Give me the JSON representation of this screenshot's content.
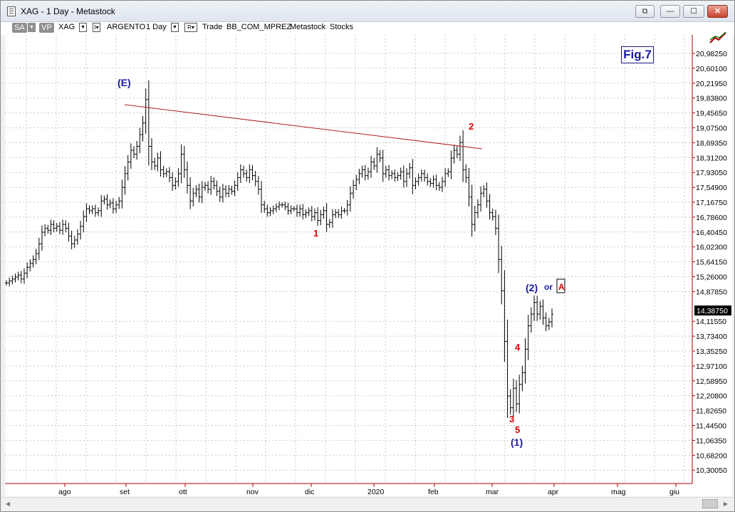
{
  "window": {
    "title": "XAG - 1 Day - Metastock",
    "buttons": {
      "restore2": "⧉",
      "minimize": "—",
      "maximize": "☐",
      "close": "✕"
    }
  },
  "toolbar": {
    "sa_label": "SA",
    "vp_label": "VP",
    "symbol": "XAG",
    "security_name": "ARGENTO",
    "periodicity": "1 Day",
    "mode": "Trade",
    "template": "BB_COM_MPREZ",
    "source": "Metastock",
    "category": "Stocks",
    "i_button": "I▾",
    "r_button": "R▾"
  },
  "figure_label": "Fig.7",
  "icons": {
    "toolbox": "chart-tool-icon",
    "app": "chart-window-icon"
  },
  "colors": {
    "bars": "#000000",
    "grid": "#c8c8c8",
    "axis": "#b00000",
    "trendline": "#b41e1e",
    "wave_red": "#e00000",
    "wave_blue": "#1a1aa0",
    "last_price_bg": "#000000"
  },
  "chart_data": {
    "type": "ohlc",
    "y_ticks": [
      "20,98250",
      "20,60100",
      "20,21950",
      "19,83800",
      "19,45650",
      "19,07500",
      "18,69350",
      "18,31200",
      "17,93050",
      "17,54900",
      "17,16750",
      "16,78600",
      "16,40450",
      "16,02300",
      "15,64150",
      "15,26000",
      "14,87850",
      "14,11550",
      "13,73400",
      "13,35250",
      "12,97100",
      "12,58950",
      "12,20800",
      "11,82650",
      "11,44500",
      "11,06350",
      "10,68200",
      "10,30050"
    ],
    "ylim": [
      10.0,
      21.3
    ],
    "last_price": "14,38750",
    "x_ticks": [
      "ago",
      "set",
      "ott",
      "nov",
      "dic",
      "2020",
      "feb",
      "mar",
      "apr",
      "mag",
      "giu"
    ],
    "closes": [
      15.1,
      15.15,
      15.2,
      15.25,
      15.3,
      15.2,
      15.35,
      15.5,
      15.6,
      15.7,
      15.85,
      16.1,
      16.4,
      16.5,
      16.45,
      16.6,
      16.5,
      16.55,
      16.45,
      16.6,
      16.5,
      16.3,
      16.1,
      16.2,
      16.35,
      16.55,
      16.8,
      17.0,
      16.95,
      17.0,
      16.9,
      16.95,
      17.2,
      17.25,
      17.1,
      17.15,
      17.0,
      17.1,
      17.2,
      17.55,
      17.9,
      18.2,
      18.5,
      18.4,
      18.6,
      18.9,
      19.2,
      19.8,
      18.6,
      18.2,
      18.1,
      18.3,
      18.0,
      17.9,
      17.95,
      17.8,
      17.6,
      17.7,
      17.9,
      18.4,
      18.0,
      17.6,
      17.2,
      17.4,
      17.5,
      17.3,
      17.55,
      17.6,
      17.5,
      17.7,
      17.6,
      17.45,
      17.3,
      17.5,
      17.4,
      17.5,
      17.45,
      17.6,
      17.8,
      18.0,
      17.9,
      17.8,
      18.0,
      17.85,
      17.7,
      17.5,
      17.1,
      17.0,
      16.9,
      16.95,
      17.0,
      17.05,
      17.1,
      17.1,
      17.05,
      16.95,
      17.0,
      17.0,
      16.9,
      17.0,
      16.85,
      16.9,
      16.95,
      16.8,
      16.9,
      16.7,
      16.85,
      16.95,
      16.6,
      16.65,
      16.85,
      16.9,
      16.85,
      16.95,
      16.95,
      17.1,
      17.4,
      17.6,
      17.75,
      17.9,
      18.0,
      17.85,
      17.95,
      18.2,
      18.1,
      18.4,
      18.3,
      17.9,
      18.0,
      17.85,
      17.9,
      17.8,
      17.85,
      17.95,
      17.7,
      17.9,
      18.05,
      17.6,
      17.7,
      17.8,
      17.9,
      17.8,
      17.7,
      17.65,
      17.75,
      17.6,
      17.55,
      17.7,
      17.9,
      17.95,
      18.3,
      18.5,
      18.4,
      18.7,
      18.0,
      17.8,
      17.3,
      16.6,
      16.9,
      17.1,
      17.4,
      17.5,
      17.2,
      16.9,
      16.8,
      16.5,
      15.7,
      14.9,
      13.6,
      12.2,
      11.9,
      12.4,
      12.0,
      12.5,
      12.8,
      13.4,
      14.0,
      14.3,
      14.6,
      14.3,
      14.5,
      14.2,
      14.0,
      14.1,
      14.3
    ]
  },
  "annotations": {
    "wave_E": "(E)",
    "wave_1": "1",
    "wave_2": "2",
    "wave_3": "3",
    "wave_4": "4",
    "wave_5": "5",
    "wave_paren1": "(1)",
    "wave_paren2": "(2)",
    "or_text": "or",
    "alt_A": "A"
  }
}
